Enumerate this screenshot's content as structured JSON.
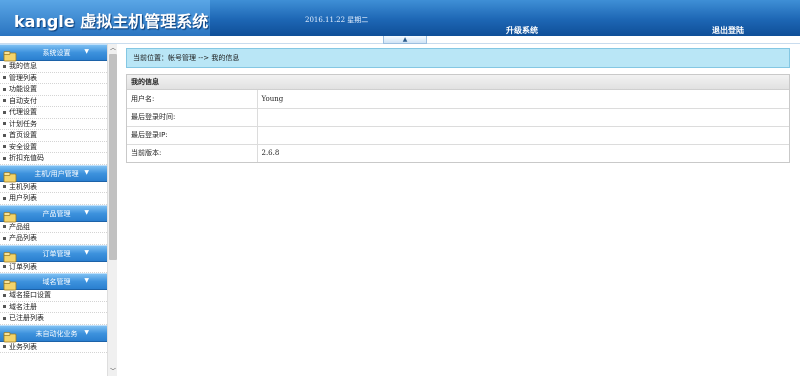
{
  "header": {
    "app_title": "kangle 虚拟主机管理系统",
    "date": "2016.11.22 星期二",
    "upgrade_label": "升级系统",
    "logout_label": "退出登陆",
    "collapse_symbol": "▲"
  },
  "sidebar": {
    "categories": [
      {
        "label": "系统设置",
        "items": [
          "我的信息",
          "管理列表",
          "功能设置",
          "自动支付",
          "代理设置",
          "计划任务",
          "首页设置",
          "安全设置",
          "折扣充值码"
        ]
      },
      {
        "label": "主机/用户管理",
        "items": [
          "主机列表",
          "用户列表"
        ]
      },
      {
        "label": "产品管理",
        "items": [
          "产品组",
          "产品列表"
        ]
      },
      {
        "label": "订单管理",
        "items": [
          "订单列表"
        ]
      },
      {
        "label": "域名管理",
        "items": [
          "域名接口设置",
          "域名注册",
          "已注册列表"
        ]
      },
      {
        "label": "未自动化业务",
        "items": [
          "业务列表"
        ]
      }
    ],
    "arrow": "▼",
    "scroll_up": "︿",
    "scroll_down": "﹀"
  },
  "breadcrumb": "当前位置：帐号管理 --> 我的信息",
  "panel": {
    "title": "我的信息",
    "rows": [
      {
        "label": "用户名:",
        "value": "Young"
      },
      {
        "label": "最后登录时间:",
        "value": ""
      },
      {
        "label": "最后登录IP:",
        "value": ""
      },
      {
        "label": "当前版本:",
        "value": "2.6.8"
      }
    ]
  },
  "colors": {
    "header_blue": "#1d66b4",
    "category_blue": "#3d92dd",
    "breadcrumb_bg": "#b9e6f6"
  }
}
